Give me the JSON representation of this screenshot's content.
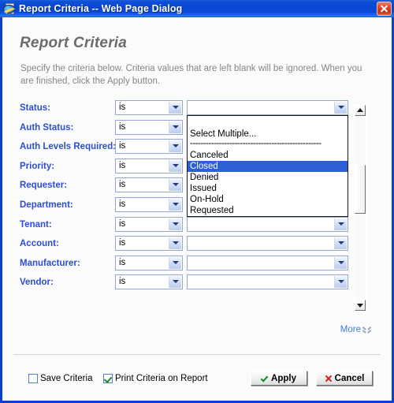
{
  "window": {
    "title": "Report Criteria -- Web Page Dialog",
    "app_icon": "internet-explorer-icon",
    "close_icon": "close-icon",
    "border_color": "#0a3fd4",
    "titlebar_color": "#0b4ad6"
  },
  "page": {
    "heading": "Report Criteria",
    "description": "Specify the criteria below. Criteria values that are left blank will be ignored. When you are finished, click the Apply button.",
    "label_color": "#2c4fd0",
    "link_color": "#3b7ddd"
  },
  "criteria": {
    "rows": [
      {
        "label": "Status:",
        "operator": "is",
        "value": ""
      },
      {
        "label": "Auth Status:",
        "operator": "is",
        "value": ""
      },
      {
        "label": "Auth Levels Required:",
        "operator": "is",
        "value": ""
      },
      {
        "label": "Priority:",
        "operator": "is",
        "value": ""
      },
      {
        "label": "Requester:",
        "operator": "is",
        "value": ""
      },
      {
        "label": "Department:",
        "operator": "is",
        "value": ""
      },
      {
        "label": "Tenant:",
        "operator": "is",
        "value": ""
      },
      {
        "label": "Account:",
        "operator": "is",
        "value": ""
      },
      {
        "label": "Manufacturer:",
        "operator": "is",
        "value": ""
      },
      {
        "label": "Vendor:",
        "operator": "is",
        "value": ""
      }
    ]
  },
  "open_dropdown": {
    "belongs_to_row": "Status:",
    "selected": "Closed",
    "options": [
      "",
      "Select Multiple...",
      "--------------------------------------------------",
      "Canceled",
      "Closed",
      "Denied",
      "Issued",
      "On-Hold",
      "Requested"
    ],
    "highlight_color": "#2f5fd4"
  },
  "scrollbar": {
    "up_icon": "scroll-up-arrow-icon",
    "down_icon": "scroll-down-arrow-icon"
  },
  "more": {
    "label": "More",
    "icon": "chevron-double-down-icon"
  },
  "footer": {
    "checkboxes": [
      {
        "label": "Save Criteria",
        "checked": false
      },
      {
        "label": "Print Criteria on Report",
        "checked": true
      }
    ],
    "buttons": [
      {
        "label": "Apply",
        "icon": "check-icon",
        "icon_color": "#0f8a23"
      },
      {
        "label": "Cancel",
        "icon": "x-icon",
        "icon_color": "#d02020"
      }
    ]
  }
}
